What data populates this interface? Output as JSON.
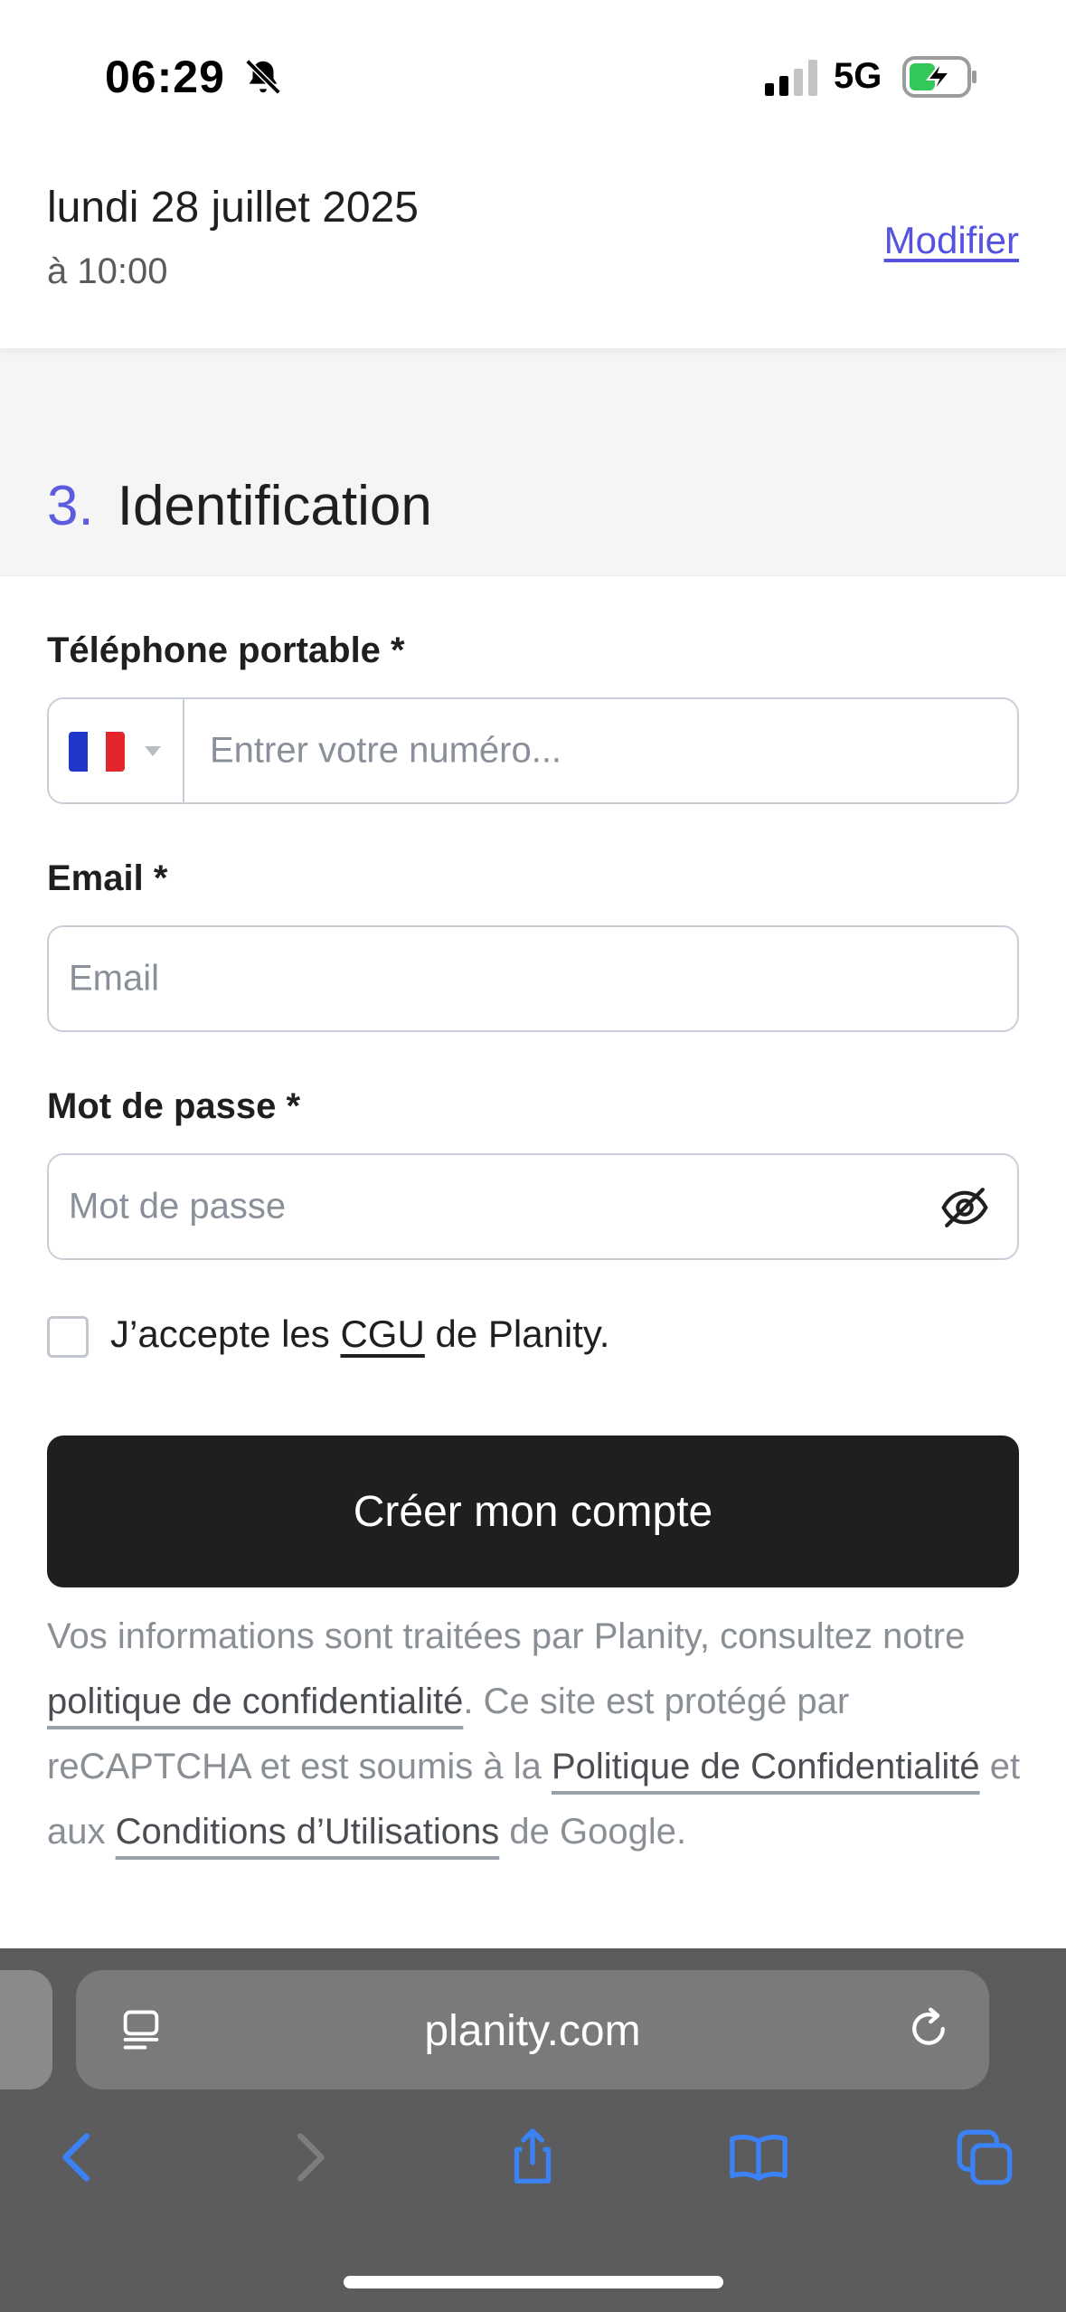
{
  "status_bar": {
    "time": "06:29",
    "network": "5G"
  },
  "appointment": {
    "date": "lundi 28 juillet 2025",
    "time": "à 10:00",
    "modify_label": "Modifier"
  },
  "section": {
    "number": "3.",
    "title": "Identification"
  },
  "form": {
    "phone": {
      "label": "Téléphone portable *",
      "placeholder": "Entrer votre numéro..."
    },
    "email": {
      "label": "Email *",
      "placeholder": "Email"
    },
    "password": {
      "label": "Mot de passe *",
      "placeholder": "Mot de passe"
    },
    "accept": {
      "prefix": "J’accepte les ",
      "link": "CGU",
      "suffix": " de Planity."
    },
    "submit_label": "Créer mon compte"
  },
  "legal": {
    "part1": "Vos informations sont traitées par Planity, consultez notre ",
    "link1": "politique de confidentialité",
    "part2": ". Ce site est protégé par reCAPTCHA et est soumis à la ",
    "link2": "Politique de Confidentialité",
    "part3": " et aux ",
    "link3": "Conditions d’Utilisations",
    "part4": " de Google."
  },
  "browser": {
    "url": "planity.com"
  },
  "colors": {
    "accent": "#5552e0",
    "button": "#1f1f1f",
    "flag_blue": "#1f37c9",
    "flag_red": "#e3262b"
  },
  "icons": {
    "status": [
      "bell-off-icon",
      "signal-icon",
      "battery-charging-icon"
    ],
    "form": [
      "france-flag-icon",
      "chevron-down-icon",
      "eye-off-icon"
    ],
    "browser": [
      "reader-icon",
      "reload-icon",
      "back-icon",
      "forward-icon",
      "share-icon",
      "bookmarks-icon",
      "tabs-icon"
    ]
  }
}
